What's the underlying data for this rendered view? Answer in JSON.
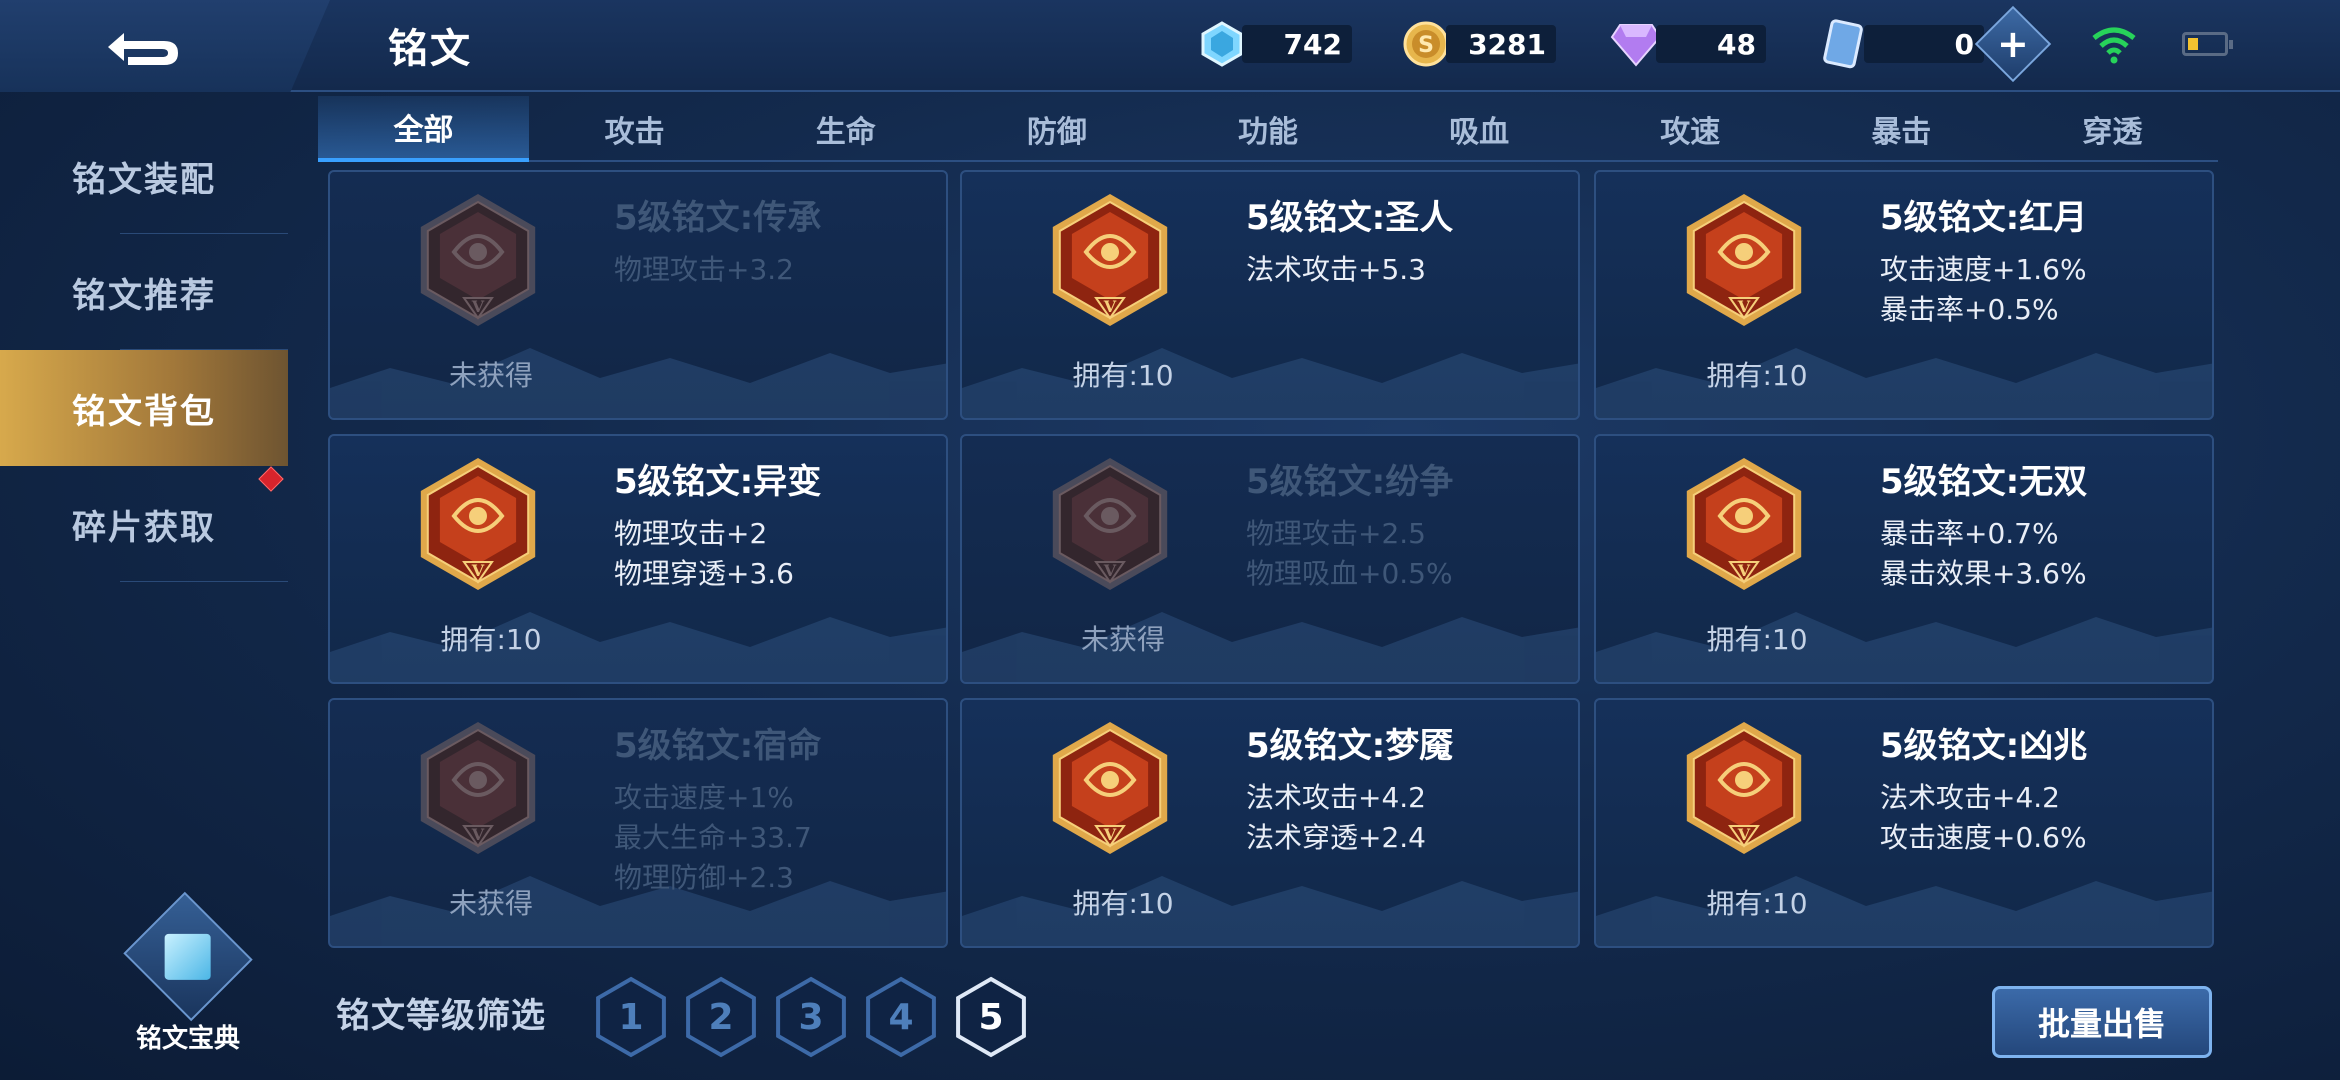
{
  "header": {
    "title": "铭文",
    "currencies": [
      {
        "icon": "diamond-icon",
        "value": "742"
      },
      {
        "icon": "gold-coin-icon",
        "value": "3281"
      },
      {
        "icon": "gem-icon",
        "value": "48"
      },
      {
        "icon": "voucher-icon",
        "value": "0"
      }
    ]
  },
  "sidebar": {
    "items": [
      {
        "label": "铭文装配"
      },
      {
        "label": "铭文推荐"
      },
      {
        "label": "铭文背包"
      },
      {
        "label": "碎片获取"
      }
    ],
    "codex_label": "铭文宝典"
  },
  "tabs": [
    "全部",
    "攻击",
    "生命",
    "防御",
    "功能",
    "吸血",
    "攻速",
    "暴击",
    "穿透"
  ],
  "runes": [
    {
      "name": "5级铭文:传承",
      "stats": [
        "物理攻击+3.2"
      ],
      "status": "未获得",
      "owned": false,
      "icon": "rune-inheritance-icon"
    },
    {
      "name": "5级铭文:圣人",
      "stats": [
        "法术攻击+5.3"
      ],
      "status": "拥有:10",
      "owned": true,
      "icon": "rune-saint-icon"
    },
    {
      "name": "5级铭文:红月",
      "stats": [
        "攻击速度+1.6%",
        "暴击率+0.5%"
      ],
      "status": "拥有:10",
      "owned": true,
      "icon": "rune-red-moon-icon"
    },
    {
      "name": "5级铭文:异变",
      "stats": [
        "物理攻击+2",
        "物理穿透+3.6"
      ],
      "status": "拥有:10",
      "owned": true,
      "icon": "rune-mutation-icon"
    },
    {
      "name": "5级铭文:纷争",
      "stats": [
        "物理攻击+2.5",
        "物理吸血+0.5%"
      ],
      "status": "未获得",
      "owned": false,
      "icon": "rune-strife-icon"
    },
    {
      "name": "5级铭文:无双",
      "stats": [
        "暴击率+0.7%",
        "暴击效果+3.6%"
      ],
      "status": "拥有:10",
      "owned": true,
      "icon": "rune-peerless-icon"
    },
    {
      "name": "5级铭文:宿命",
      "stats": [
        "攻击速度+1%",
        "最大生命+33.7",
        "物理防御+2.3"
      ],
      "status": "未获得",
      "owned": false,
      "icon": "rune-fate-icon"
    },
    {
      "name": "5级铭文:梦魇",
      "stats": [
        "法术攻击+4.2",
        "法术穿透+2.4"
      ],
      "status": "拥有:10",
      "owned": true,
      "icon": "rune-nightmare-icon"
    },
    {
      "name": "5级铭文:凶兆",
      "stats": [
        "法术攻击+4.2",
        "攻击速度+0.6%"
      ],
      "status": "拥有:10",
      "owned": true,
      "icon": "rune-omen-icon"
    }
  ],
  "rune_level_mark": "V",
  "filter": {
    "label": "铭文等级筛选",
    "levels": [
      "1",
      "2",
      "3",
      "4",
      "5"
    ],
    "selected": "5"
  },
  "sell_button": "批量出售",
  "colors": {
    "accent_gold": "#d7a94c",
    "tab_blue": "#39a0ff",
    "rune_red": "#c53a1a"
  }
}
